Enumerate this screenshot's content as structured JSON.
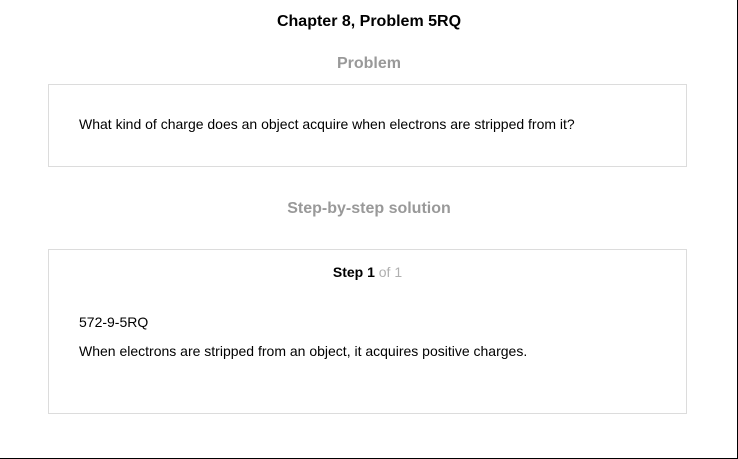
{
  "header": {
    "chapter_title": "Chapter 8, Problem 5RQ"
  },
  "problem": {
    "heading": "Problem",
    "text": "What kind of charge does an object acquire when electrons are stripped from it?"
  },
  "solution": {
    "heading": "Step-by-step solution",
    "step": {
      "label": "Step 1",
      "of_text": " of 1",
      "image_ref": "572-9-5RQ",
      "text": "When electrons are stripped from an object, it acquires positive charges."
    }
  }
}
